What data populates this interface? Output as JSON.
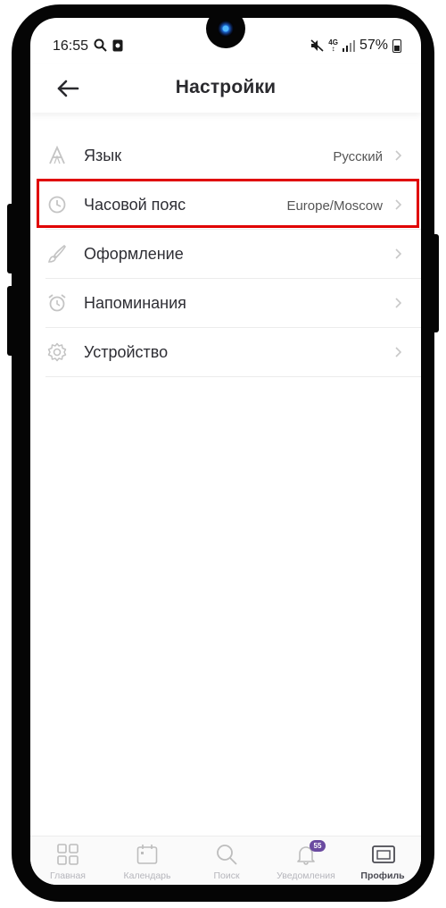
{
  "status_bar": {
    "time": "16:55",
    "battery": "57%",
    "network": "4G"
  },
  "header": {
    "title": "Настройки"
  },
  "settings": [
    {
      "label": "Язык",
      "value": "Русский",
      "icon": "font-icon"
    },
    {
      "label": "Часовой пояс",
      "value": "Europe/Moscow",
      "icon": "clock-icon"
    },
    {
      "label": "Оформление",
      "value": "",
      "icon": "brush-icon"
    },
    {
      "label": "Напоминания",
      "value": "",
      "icon": "alarm-icon"
    },
    {
      "label": "Устройство",
      "value": "",
      "icon": "gear-icon"
    }
  ],
  "tabbar": {
    "tabs": [
      {
        "label": "Главная",
        "icon": "grid-icon"
      },
      {
        "label": "Календарь",
        "icon": "calendar-icon"
      },
      {
        "label": "Поиск",
        "icon": "search-icon"
      },
      {
        "label": "Уведомления",
        "icon": "bell-icon",
        "badge": "55"
      },
      {
        "label": "Профиль",
        "icon": "profile-card-icon",
        "active": true
      }
    ]
  },
  "colors": {
    "highlight": "#e00000",
    "badge": "#6a4aa0",
    "icon_gray": "#bdbdbd"
  }
}
